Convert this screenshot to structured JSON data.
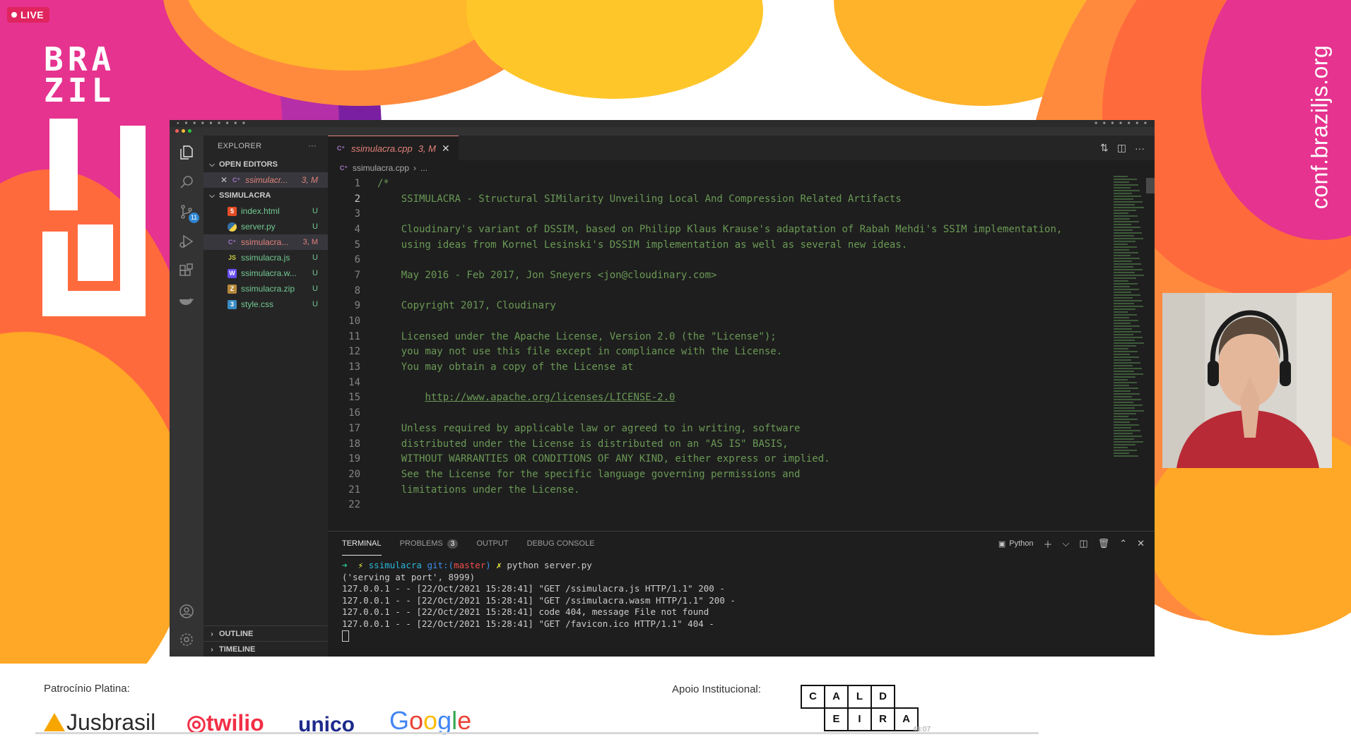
{
  "live_label": "LIVE",
  "logo": {
    "line1": "BRA",
    "line2": "ZIL"
  },
  "side_url": "conf.braziljs.org",
  "activity_bar": {
    "icons": [
      "explorer-icon",
      "search-icon",
      "source-control-icon",
      "run-debug-icon",
      "extensions-icon",
      "docker-icon",
      "account-icon",
      "manage-gear-icon"
    ],
    "scm_badge": "11"
  },
  "sidebar": {
    "title": "EXPLORER",
    "more": "···",
    "open_editors_title": "OPEN EDITORS",
    "open_editor": {
      "name": "ssimulacr...",
      "status": "3, M"
    },
    "project_title": "SSIMULACRA",
    "files": [
      {
        "name": "index.html",
        "status": "U",
        "icon": "5",
        "color": "#e44d26"
      },
      {
        "name": "server.py",
        "status": "U",
        "icon": "py",
        "color": "#3572a5"
      },
      {
        "name": "ssimulacra...",
        "status": "3, M",
        "icon": "C++",
        "color": "#a074c4"
      },
      {
        "name": "ssimulacra.js",
        "status": "U",
        "icon": "JS",
        "color": "#cbcb41"
      },
      {
        "name": "ssimulacra.w...",
        "status": "U",
        "icon": "W",
        "color": "#654ff0"
      },
      {
        "name": "ssimulacra.zip",
        "status": "U",
        "icon": "Z",
        "color": "#b5883a"
      },
      {
        "name": "style.css",
        "status": "U",
        "icon": "3",
        "color": "#3a8cc4"
      }
    ],
    "outline_title": "OUTLINE",
    "timeline_title": "TIMELINE"
  },
  "editor": {
    "tab_label": "ssimulacra.cpp",
    "tab_status": "3, M",
    "tab_close": "✕",
    "breadcrumb_file": "ssimulacra.cpp",
    "breadcrumb_more": "...",
    "lines": [
      {
        "n": "1",
        "text": "/*"
      },
      {
        "n": "2",
        "text": "    SSIMULACRA - Structural SIMilarity Unveiling Local And Compression Related Artifacts"
      },
      {
        "n": "3",
        "text": ""
      },
      {
        "n": "4",
        "text": "    Cloudinary's variant of DSSIM, based on Philipp Klaus Krause's adaptation of Rabah Mehdi's SSIM implementation,"
      },
      {
        "n": "5",
        "text": "    using ideas from Kornel Lesinski's DSSIM implementation as well as several new ideas."
      },
      {
        "n": "6",
        "text": ""
      },
      {
        "n": "7",
        "text": "    May 2016 - Feb 2017, Jon Sneyers <jon@cloudinary.com>"
      },
      {
        "n": "8",
        "text": ""
      },
      {
        "n": "9",
        "text": "    Copyright 2017, Cloudinary"
      },
      {
        "n": "10",
        "text": ""
      },
      {
        "n": "11",
        "text": "    Licensed under the Apache License, Version 2.0 (the \"License\");"
      },
      {
        "n": "12",
        "text": "    you may not use this file except in compliance with the License."
      },
      {
        "n": "13",
        "text": "    You may obtain a copy of the License at"
      },
      {
        "n": "14",
        "text": ""
      },
      {
        "n": "15",
        "text": "        ",
        "link": "http://www.apache.org/licenses/LICENSE-2.0"
      },
      {
        "n": "16",
        "text": ""
      },
      {
        "n": "17",
        "text": "    Unless required by applicable law or agreed to in writing, software"
      },
      {
        "n": "18",
        "text": "    distributed under the License is distributed on an \"AS IS\" BASIS,"
      },
      {
        "n": "19",
        "text": "    WITHOUT WARRANTIES OR CONDITIONS OF ANY KIND, either express or implied."
      },
      {
        "n": "20",
        "text": "    See the License for the specific language governing permissions and"
      },
      {
        "n": "21",
        "text": "    limitations under the License."
      },
      {
        "n": "22",
        "text": ""
      }
    ],
    "current_line": "2"
  },
  "panel": {
    "tabs": {
      "terminal": "TERMINAL",
      "problems": "PROBLEMS",
      "problems_count": "3",
      "output": "OUTPUT",
      "debug": "DEBUG CONSOLE"
    },
    "shell_label": "Python",
    "terminal": {
      "prompt_arrow": "➜",
      "prompt_bolt": "⚡",
      "prompt_dir": "ssimulacra",
      "prompt_git": "git:(",
      "prompt_branch": "master",
      "prompt_git_close": ")",
      "prompt_x": "✗",
      "prompt_cmd": "python server.py",
      "output": [
        "('serving at port', 8999)",
        "127.0.0.1 - - [22/Oct/2021 15:28:41] \"GET /ssimulacra.js HTTP/1.1\" 200 -",
        "127.0.0.1 - - [22/Oct/2021 15:28:41] \"GET /ssimulacra.wasm HTTP/1.1\" 200 -",
        "127.0.0.1 - - [22/Oct/2021 15:28:41] code 404, message File not found",
        "127.0.0.1 - - [22/Oct/2021 15:28:41] \"GET /favicon.ico HTTP/1.1\" 404 -"
      ]
    }
  },
  "sponsors": {
    "platinum_label": "Patrocínio Platina:",
    "institutional_label": "Apoio Institucional:",
    "logos": [
      "Jusbrasil",
      "twilio",
      "unico",
      "Google"
    ],
    "caldeira_letters": [
      "C",
      "A",
      "L",
      "D",
      "E",
      "I",
      "R",
      "A"
    ]
  },
  "timecode": "48:07",
  "colors": {
    "live": "#e0245e",
    "vscode_bg": "#1e1e1e",
    "comment": "#6a9955",
    "git_untracked": "#73c991",
    "modified": "#e2827a"
  }
}
